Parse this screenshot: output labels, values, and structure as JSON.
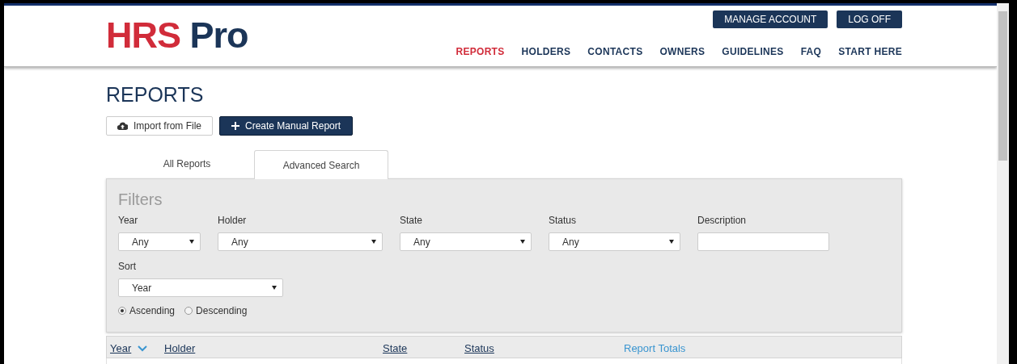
{
  "logo": {
    "part_1": "HRS",
    "part_2": "Pro"
  },
  "account_buttons": [
    "MANAGE ACCOUNT",
    "LOG OFF"
  ],
  "nav": [
    {
      "label": "REPORTS",
      "selected": true
    },
    {
      "label": "HOLDERS",
      "selected": false
    },
    {
      "label": "CONTACTS",
      "selected": false
    },
    {
      "label": "OWNERS",
      "selected": false
    },
    {
      "label": "GUIDELINES",
      "selected": false
    },
    {
      "label": "FAQ",
      "selected": false
    },
    {
      "label": "START HERE",
      "selected": false
    }
  ],
  "page_title": "REPORTS",
  "actions": [
    {
      "kind": "import",
      "label": "Import from File"
    },
    {
      "kind": "create",
      "label": "Create Manual Report"
    }
  ],
  "tabs": [
    {
      "label": "All Reports",
      "selected": false
    },
    {
      "label": "Advanced Search",
      "selected": true
    }
  ],
  "filters": {
    "title": "Filters",
    "fields": [
      {
        "kind": "select",
        "label": "Year",
        "value": "Any"
      },
      {
        "kind": "select",
        "label": "Holder",
        "value": "Any"
      },
      {
        "kind": "select",
        "label": "State",
        "value": "Any"
      },
      {
        "kind": "select",
        "label": "Status",
        "value": "Any"
      },
      {
        "kind": "text",
        "label": "Description"
      }
    ],
    "sort": {
      "label": "Sort",
      "value": "Year"
    },
    "order": [
      {
        "label": "Ascending",
        "selected": true
      },
      {
        "label": "Descending",
        "selected": false
      }
    ]
  },
  "table": {
    "columns": [
      {
        "kind": "sort",
        "label": "Year",
        "sorted": true
      },
      {
        "kind": "sort",
        "label": "Holder",
        "sorted": false
      },
      {
        "kind": "sort",
        "label": "State",
        "sorted": false
      },
      {
        "kind": "sort",
        "label": "Status",
        "sorted": false
      },
      {
        "kind": "group",
        "label": "Report Totals",
        "sorted": false
      }
    ]
  }
}
